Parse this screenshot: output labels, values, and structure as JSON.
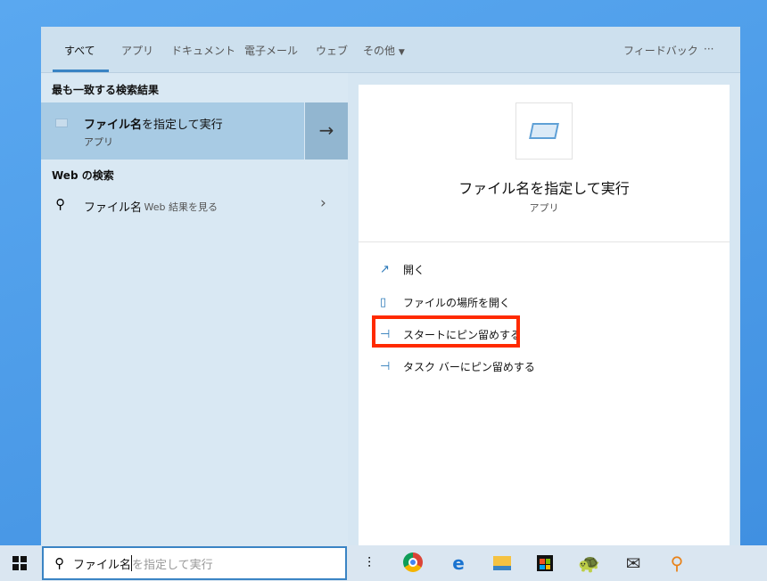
{
  "tabs": {
    "all": "すべて",
    "apps": "アプリ",
    "documents": "ドキュメント",
    "email": "電子メール",
    "web": "ウェブ",
    "more": "その他",
    "feedback": "フィードバック",
    "ellipsis": "···"
  },
  "left": {
    "best_match_heading": "最も一致する検索結果",
    "best_match": {
      "title_bold": "ファイル名",
      "title_rest": "を指定して実行",
      "subtitle": "アプリ"
    },
    "web_heading": "Web の検索",
    "web_result": {
      "query": "ファイル名",
      "suffix": " - Web 結果を見る"
    }
  },
  "right": {
    "title": "ファイル名を指定して実行",
    "subtitle": "アプリ",
    "actions": [
      "開く",
      "ファイルの場所を開く",
      "スタートにピン留めする",
      "タスク バーにピン留めする"
    ]
  },
  "taskbar": {
    "typed": "ファイル名",
    "suggestion": "を指定して実行"
  },
  "colors": {
    "accent": "#3a84c4",
    "highlight": "#ff2a00"
  }
}
